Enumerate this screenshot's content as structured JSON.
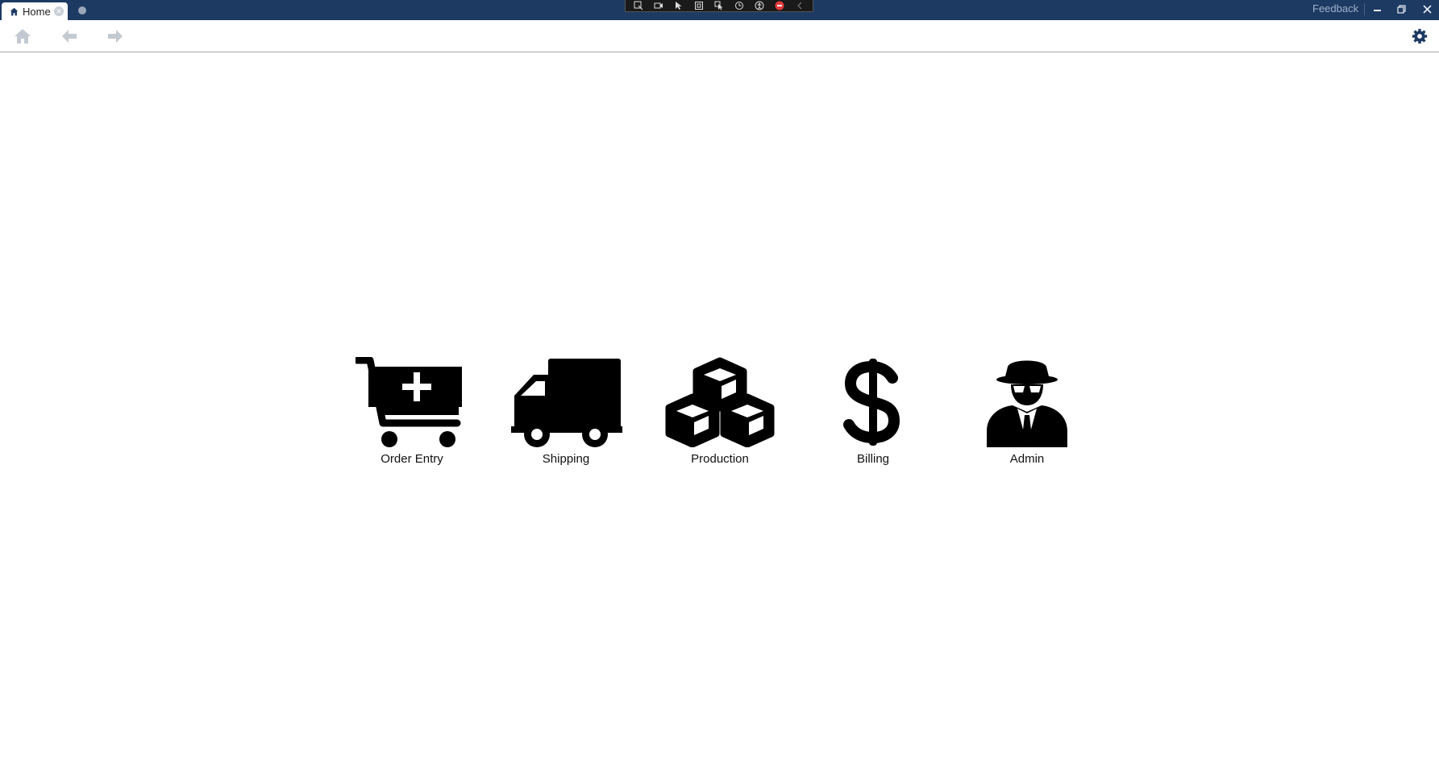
{
  "tabs": [
    {
      "label": "Home",
      "icon": "home-icon",
      "close_icon": "close-circle-icon"
    }
  ],
  "titlebar": {
    "feedback_label": "Feedback",
    "background_color": "#1d3a63"
  },
  "devtools": {
    "icons": [
      "select-element-icon",
      "video-icon",
      "pointer-icon",
      "frame-icon",
      "pointer-highlight-icon",
      "hot-reload-icon",
      "accessibility-icon",
      "stop-icon",
      "collapse-icon"
    ]
  },
  "toolbar": {
    "buttons": [
      "home-icon",
      "back-arrow-icon",
      "forward-arrow-icon",
      "gear-icon"
    ]
  },
  "modules": [
    {
      "label": "Order Entry",
      "icon": "cart-plus-icon"
    },
    {
      "label": "Shipping",
      "icon": "truck-icon"
    },
    {
      "label": "Production",
      "icon": "cubes-icon"
    },
    {
      "label": "Billing",
      "icon": "dollar-icon"
    },
    {
      "label": "Admin",
      "icon": "spy-icon"
    }
  ]
}
